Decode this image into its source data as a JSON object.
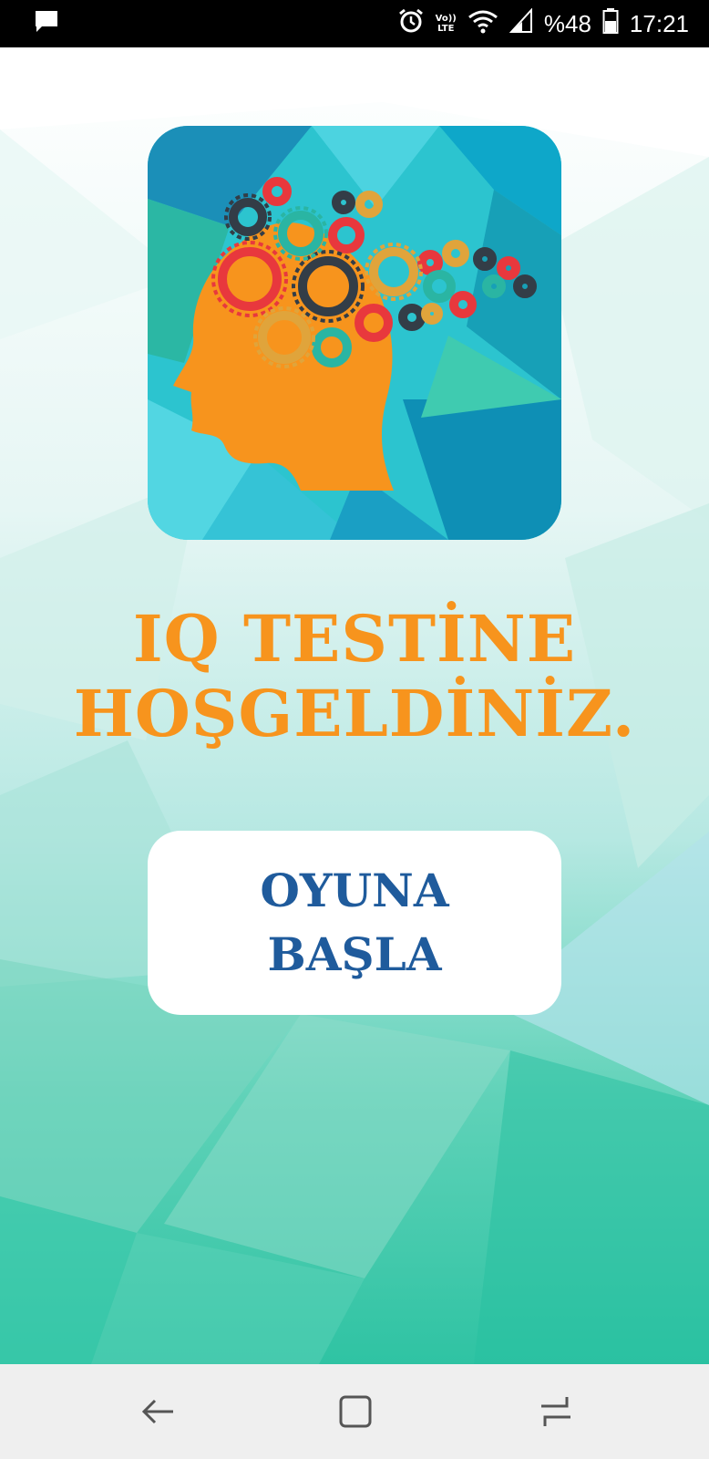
{
  "status_bar": {
    "battery": "%48",
    "time": "17:21",
    "volte_label_top": "Vo))",
    "volte_label_bottom": "LTE",
    "icons": [
      "message-icon",
      "alarm-icon",
      "volte-icon",
      "wifi-icon",
      "signal-icon",
      "battery-icon"
    ]
  },
  "main": {
    "title_line1": "IQ TESTİNE",
    "title_line2": "HOŞGELDİNİZ.",
    "start_button_line1": "OYUNA",
    "start_button_line2": "BAŞLA",
    "logo_icon": "brain-gears-icon"
  },
  "nav_bar": {
    "icons": [
      "back-icon",
      "home-icon",
      "recents-icon"
    ]
  },
  "colors": {
    "title": "#f7941d",
    "button_text": "#1f5b9c",
    "head": "#f7941d"
  }
}
